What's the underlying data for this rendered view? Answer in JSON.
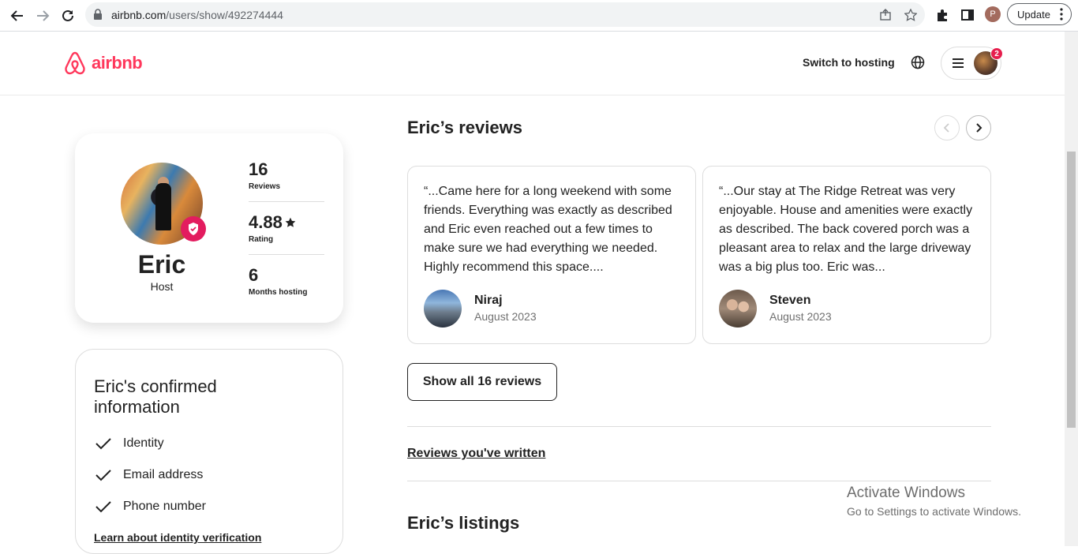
{
  "browser": {
    "url_host": "airbnb.com",
    "url_path": "/users/show/492274444",
    "profile_initial": "P",
    "update_label": "Update"
  },
  "header": {
    "logo_text": "airbnb",
    "switch_hosting": "Switch to hosting",
    "notification_count": "2",
    "brand_color": "#ff385c"
  },
  "profile": {
    "name": "Eric",
    "role": "Host",
    "stats": [
      {
        "value": "16",
        "label": "Reviews"
      },
      {
        "value": "4.88",
        "label": "Rating"
      },
      {
        "value": "6",
        "label": "Months hosting"
      }
    ]
  },
  "confirmed": {
    "title": "Eric's confirmed information",
    "items": [
      "Identity",
      "Email address",
      "Phone number"
    ],
    "learn_link": "Learn about identity verification"
  },
  "reviews": {
    "title": "Eric’s reviews",
    "items": [
      {
        "text": "“...Came here for a long weekend with some friends. Everything was exactly as described and Eric even reached out a few times to make sure we had everything we needed. Highly recommend this space....",
        "name": "Niraj",
        "date": "August 2023"
      },
      {
        "text": "“...Our stay at The Ridge Retreat was very enjoyable. House and amenities were exactly as described. The back covered porch was a pleasant area to relax and the large driveway was a big plus too. Eric was...",
        "name": "Steven",
        "date": "August 2023"
      }
    ],
    "show_all": "Show all 16 reviews",
    "written_link": "Reviews you've written",
    "listings_title": "Eric’s listings"
  },
  "watermark": {
    "line1": "Activate Windows",
    "line2": "Go to Settings to activate Windows."
  }
}
